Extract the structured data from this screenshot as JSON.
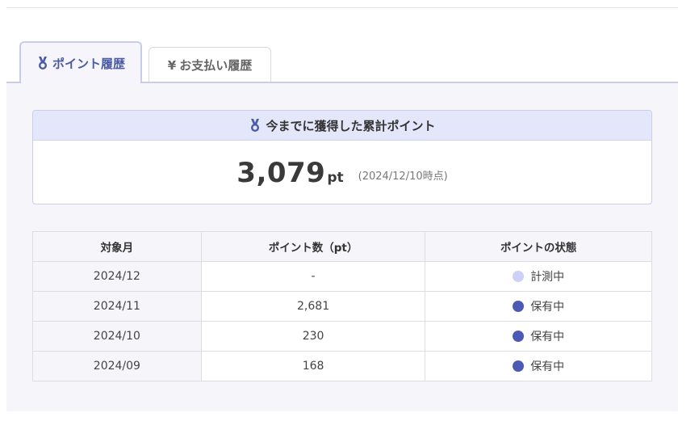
{
  "tabs": {
    "points_history": {
      "label": "ポイント履歴",
      "icon": "medal-icon",
      "active": true
    },
    "payment_history": {
      "label": "お支払い履歴",
      "icon": "yen-icon",
      "icon_glyph": "¥",
      "active": false
    }
  },
  "summary": {
    "title": "今までに獲得した累計ポイント",
    "total": "3,079",
    "unit": "pt",
    "as_of": "(2024/12/10時点)"
  },
  "table": {
    "headers": {
      "month": "対象月",
      "points": "ポイント数（pt）",
      "status": "ポイントの状態"
    },
    "rows": [
      {
        "month": "2024/12",
        "points": "-",
        "status": "計測中",
        "status_color": "#ccd1f5"
      },
      {
        "month": "2024/11",
        "points": "2,681",
        "status": "保有中",
        "status_color": "#4b5ab4"
      },
      {
        "month": "2024/10",
        "points": "230",
        "status": "保有中",
        "status_color": "#4b5ab4"
      },
      {
        "month": "2024/09",
        "points": "168",
        "status": "保有中",
        "status_color": "#4b5ab4"
      }
    ]
  },
  "colors": {
    "accent": "#4b5aa5",
    "header_bg": "#e4e7fa",
    "panel_bg": "#f5f5fa"
  }
}
